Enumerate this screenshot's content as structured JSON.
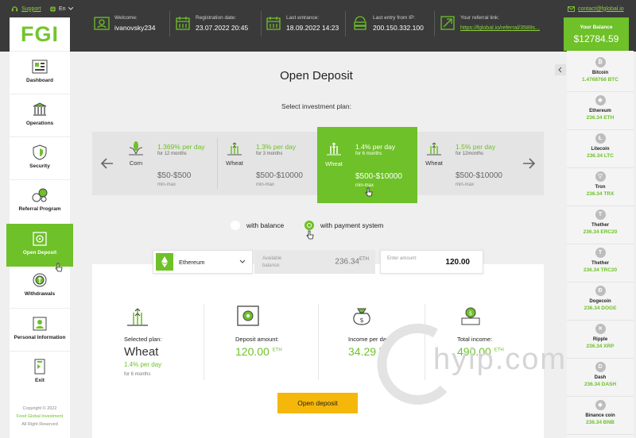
{
  "topbar": {
    "support": "Support",
    "lang": "En",
    "email": "contact@fglobal.io",
    "welcome": {
      "label": "Welcome:",
      "value": "ivanovsky234"
    },
    "registration": {
      "label": "Registration date:",
      "value": "23.07.2022  20:45"
    },
    "last_entrance": {
      "label": "Last entrance:",
      "value": "18.09.2022  14:23"
    },
    "last_ip": {
      "label": "Last entry from IP:",
      "value": "200.150.332.100"
    },
    "referral": {
      "label": "Your referral link:",
      "value": "https://fglobal.io/referral/3589s..."
    },
    "balance": {
      "label": "Your Balance",
      "value": "$12784.59"
    }
  },
  "sidebar": {
    "logo": "FGI",
    "items": [
      {
        "label": "Dashboard",
        "icon": "dashboard-icon"
      },
      {
        "label": "Operations",
        "icon": "operations-icon"
      },
      {
        "label": "Security",
        "icon": "security-shield-icon"
      },
      {
        "label": "Referral Program",
        "icon": "referral-icon"
      },
      {
        "label": "Open Deposit",
        "icon": "safe-icon",
        "active": true
      },
      {
        "label": "Withdrawals",
        "icon": "withdrawals-icon"
      },
      {
        "label": "Personal Information",
        "icon": "personal-info-icon"
      },
      {
        "label": "Exit",
        "icon": "exit-icon"
      }
    ],
    "copyright": "Copyright © 2022",
    "company": "Food Global Investment",
    "rights": "All Right Reserved"
  },
  "main": {
    "title": "Open Deposit",
    "subtitle": "Select investment plan:",
    "plans": [
      {
        "name": "Corn",
        "rate": "1.369% per day",
        "period": "for 12 months",
        "amount": "$50-$500",
        "minmax": "min-max"
      },
      {
        "name": "Wheat",
        "rate": "1.3% per day",
        "period": "for 3 months",
        "amount": "$500-$10000",
        "minmax": "min-max"
      },
      {
        "name": "Wheat",
        "rate": "1.4% per day",
        "period": "for 6 months",
        "amount": "$500-$10000",
        "minmax": "min-max",
        "selected": true
      },
      {
        "name": "Wheat",
        "rate": "1.5% per day",
        "period": "for 12months",
        "amount": "$500-$10000",
        "minmax": "min-max"
      }
    ],
    "radio_balance": "with balance",
    "radio_payment": "with payment system",
    "currency": "Ethereum",
    "available_label": "Available balance:",
    "available_value": "236.34",
    "available_unit": "ETH",
    "enter_label": "Enter amount:",
    "enter_value": "120.00",
    "summary": {
      "plan_label": "Selected plan:",
      "plan_name": "Wheat",
      "plan_rate": "1.4% per day",
      "plan_period": "for 6 months",
      "deposit_label": "Deposit amount:",
      "deposit_value": "120.00",
      "income_day_label": "Income per day:",
      "income_day_value": "34.29",
      "total_label": "Total income:",
      "total_value": "490.00",
      "unit": "ETH"
    },
    "open_button": "Open deposit"
  },
  "coins": [
    {
      "name": "Bitcoin",
      "value": "1.4768768 BTC",
      "glyph": "₿"
    },
    {
      "name": "Ethereum",
      "value": "236.34 ETH",
      "glyph": "◆"
    },
    {
      "name": "Litecoin",
      "value": "236.34 LTC",
      "glyph": "Ł"
    },
    {
      "name": "Tron",
      "value": "236.34 TRX",
      "glyph": "▽"
    },
    {
      "name": "Thether",
      "value": "236.34 ERC20",
      "glyph": "T"
    },
    {
      "name": "Thether",
      "value": "236.34 TRC20",
      "glyph": "T"
    },
    {
      "name": "Dogecoin",
      "value": "236.34 DOGE",
      "glyph": "Ð"
    },
    {
      "name": "Ripple",
      "value": "236.34 XRP",
      "glyph": "✕"
    },
    {
      "name": "Dash",
      "value": "236.34 DASH",
      "glyph": "D"
    },
    {
      "name": "Binance coin",
      "value": "236.34 BNB",
      "glyph": "◈"
    }
  ],
  "colors": {
    "accent": "#6ec128",
    "topbar": "#3a3a3a",
    "button": "#f5b70a"
  }
}
